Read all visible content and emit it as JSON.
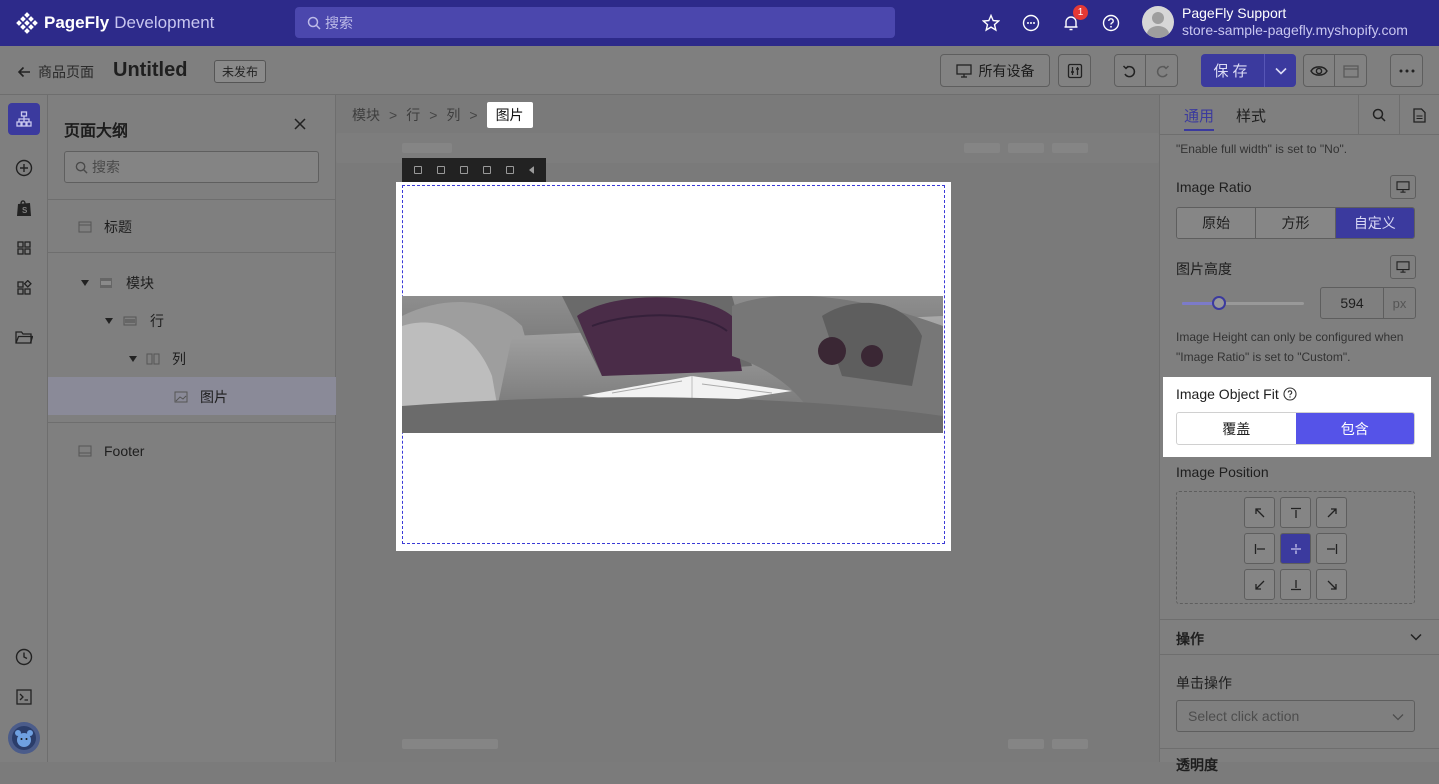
{
  "app": {
    "brand": "PageFly",
    "env": "Development"
  },
  "search": {
    "placeholder": "搜索"
  },
  "notifications": {
    "count": "1"
  },
  "user": {
    "name": "PageFly Support",
    "store": "store-sample-pagefly.myshopify.com"
  },
  "toolbar": {
    "back_label": "商品页面",
    "page_title": "Untitled",
    "status": "未发布",
    "device_label": "所有设备",
    "save_label": "保存"
  },
  "outline": {
    "title": "页面大纲",
    "search_placeholder": "搜索",
    "items": [
      {
        "label": "标题"
      },
      {
        "label": "模块"
      },
      {
        "label": "行"
      },
      {
        "label": "列"
      },
      {
        "label": "图片"
      },
      {
        "label": "Footer"
      }
    ]
  },
  "breadcrumb": [
    "模块",
    "行",
    "列",
    "图片"
  ],
  "panel": {
    "tabs": [
      "通用",
      "样式"
    ],
    "top_note": "\"Enable full width\" is set to \"No\".",
    "image_ratio": {
      "label": "Image Ratio",
      "options": [
        "原始",
        "方形",
        "自定义"
      ],
      "selected": "自定义"
    },
    "image_height": {
      "label": "图片高度",
      "value": "594",
      "unit": "px",
      "slider_fraction": 0.3
    },
    "height_note": "Image Height can only be configured when \"Image Ratio\" is set to \"Custom\".",
    "object_fit": {
      "label": "Image Object Fit",
      "options": [
        "覆盖",
        "包含"
      ],
      "selected": "包含"
    },
    "image_position": {
      "label": "Image Position",
      "selected": "center"
    },
    "action_section": "操作",
    "click_action": {
      "label": "单击操作",
      "placeholder": "Select click action"
    },
    "next_section": "透明度"
  },
  "colors": {
    "brand": "#2d2a8a",
    "accent": "#5553e8",
    "highlight_bg": "#ffffff"
  }
}
